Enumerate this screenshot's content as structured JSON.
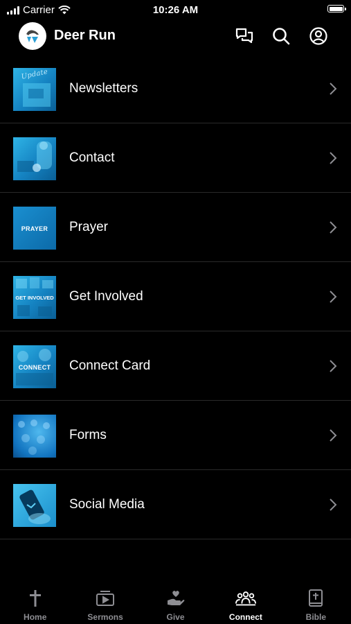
{
  "status_bar": {
    "carrier": "Carrier",
    "time": "10:26 AM"
  },
  "header": {
    "title": "Deer Run"
  },
  "thumb_color": "#1E9FD8",
  "menu": {
    "items": [
      {
        "label": "Newsletters",
        "thumb_text": "Update",
        "icon": "newsletter-image"
      },
      {
        "label": "Contact",
        "thumb_text": "",
        "icon": "contact-image"
      },
      {
        "label": "Prayer",
        "thumb_text": "PRAYER",
        "icon": "prayer-image"
      },
      {
        "label": "Get Involved",
        "thumb_text": "GET INVOLVED",
        "icon": "get-involved-image"
      },
      {
        "label": "Connect Card",
        "thumb_text": "CONNECT",
        "icon": "connect-card-image"
      },
      {
        "label": "Forms",
        "thumb_text": "",
        "icon": "forms-image"
      },
      {
        "label": "Social Media",
        "thumb_text": "",
        "icon": "social-media-image"
      }
    ]
  },
  "tabs": [
    {
      "label": "Home",
      "icon": "cross-icon",
      "active": false
    },
    {
      "label": "Sermons",
      "icon": "video-play-icon",
      "active": false
    },
    {
      "label": "Give",
      "icon": "heart-hand-icon",
      "active": false
    },
    {
      "label": "Connect",
      "icon": "people-group-icon",
      "active": true
    },
    {
      "label": "Bible",
      "icon": "bible-icon",
      "active": false
    }
  ]
}
